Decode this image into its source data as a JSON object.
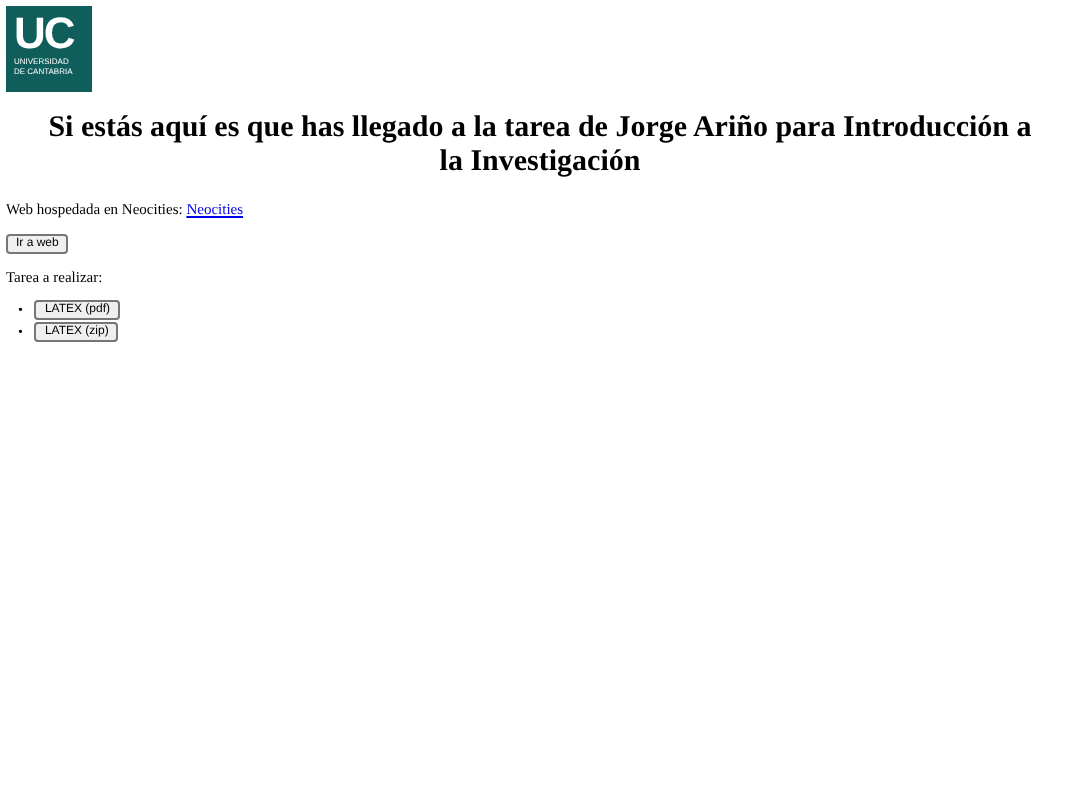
{
  "logo": {
    "initials": "UC",
    "lines": [
      "UNIVERSIDAD",
      "DE CANTABRIA"
    ]
  },
  "heading": "Si estás aquí es que has llegado a la tarea de Jorge Ariño para Introducción a la Investigación",
  "hosting": {
    "text": "Web hospedada en Neocities:",
    "link": "Neocities"
  },
  "visit_button": "Ir a web",
  "task_label": "Tarea a realizar:",
  "downloads": [
    {
      "marker": "•",
      "label": "LATEX (pdf)"
    },
    {
      "marker": "•",
      "label": "LATEX (zip)"
    }
  ]
}
